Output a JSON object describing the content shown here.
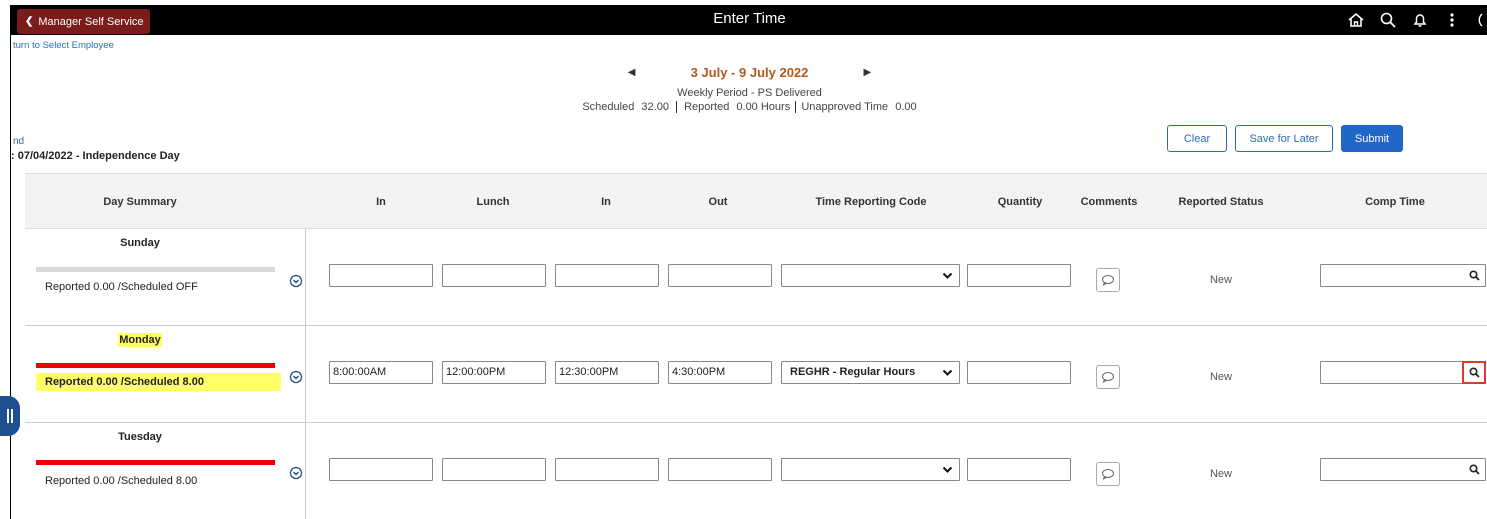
{
  "header": {
    "back_label": "Manager Self Service",
    "title": "Enter Time",
    "icons": [
      "home-icon",
      "search-icon",
      "notification-bell-icon",
      "more-actions-icon"
    ]
  },
  "return_link": "turn to Select Employee",
  "period": {
    "range": "3 July - 9 July 2022",
    "type": "Weekly Period - PS Delivered",
    "scheduled_label": "Scheduled",
    "scheduled_value": "32.00",
    "reported_label": "Reported",
    "reported_value": "0.00 Hours",
    "unapproved_label": "Unapproved Time",
    "unapproved_value": "0.00"
  },
  "legend_link": "nd",
  "holiday_note": ": 07/04/2022 - Independence Day",
  "actions": {
    "clear": "Clear",
    "save": "Save for Later",
    "submit": "Submit"
  },
  "columns": {
    "day_summary": "Day Summary",
    "in1": "In",
    "lunch": "Lunch",
    "in2": "In",
    "out": "Out",
    "trc": "Time Reporting Code",
    "quantity": "Quantity",
    "comments": "Comments",
    "status": "Reported Status",
    "comp": "Comp Time"
  },
  "rows": [
    {
      "day": "Sunday",
      "summary": "Reported 0.00 /Scheduled OFF",
      "in1": "",
      "lunch": "",
      "in2": "",
      "out": "",
      "trc": "",
      "quantity": "",
      "status": "New",
      "comp": ""
    },
    {
      "day": "Monday",
      "summary": "Reported 0.00 /Scheduled 8.00",
      "in1": "8:00:00AM",
      "lunch": "12:00:00PM",
      "in2": "12:30:00PM",
      "out": "4:30:00PM",
      "trc": "REGHR - Regular Hours",
      "quantity": "",
      "status": "New",
      "comp": ""
    },
    {
      "day": "Tuesday",
      "summary": "Reported 0.00 /Scheduled 8.00",
      "in1": "",
      "lunch": "",
      "in2": "",
      "out": "",
      "trc": "",
      "quantity": "",
      "status": "New",
      "comp": ""
    }
  ],
  "colors": {
    "header_bg": "#000000",
    "back_button": "#7b1c1c",
    "period_range": "#b05a1a",
    "primary_button": "#2167c7",
    "highlight": "#ffff66",
    "scheduled_bar": "#e00000",
    "off_bar": "#d9d9d9",
    "focus_outline": "#e0392b"
  }
}
